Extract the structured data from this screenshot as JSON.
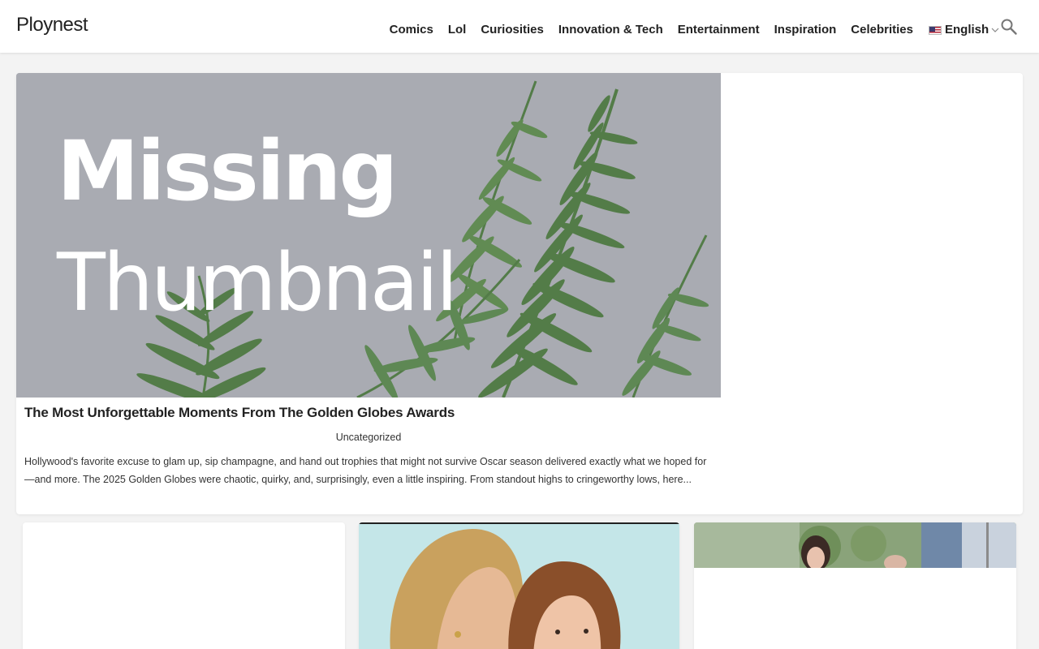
{
  "site": {
    "logo": "Ploynest"
  },
  "nav": {
    "items": [
      {
        "label": "Comics"
      },
      {
        "label": "Lol"
      },
      {
        "label": "Curiosities"
      },
      {
        "label": "Innovation & Tech"
      },
      {
        "label": "Entertainment"
      },
      {
        "label": "Inspiration"
      },
      {
        "label": "Celebrities"
      }
    ],
    "language": {
      "label": "English",
      "flag_icon": "us-flag-icon",
      "dropdown_icon": "chevron-down-icon"
    },
    "search_icon": "search-icon"
  },
  "featured": {
    "thumbnail_text_line1": "Missing",
    "thumbnail_text_line2": "Thumbnail",
    "title": "The Most Unforgettable Moments From The Golden Globes Awards",
    "category": "Uncategorized",
    "excerpt": "Hollywood's favorite excuse to glam up, sip champagne, and hand out trophies that might not survive Oscar season delivered exactly what we hoped for—and more. The 2025 Golden Globes were chaotic, quirky, and, surprisingly, even a little inspiring. From standout highs to cringeworthy lows, here..."
  },
  "colors": {
    "page_background": "#f3f3f3",
    "card_background": "#ffffff",
    "text": "#222222",
    "thumbnail_background": "#a9abb2",
    "fern_green": "#4f7a43"
  }
}
